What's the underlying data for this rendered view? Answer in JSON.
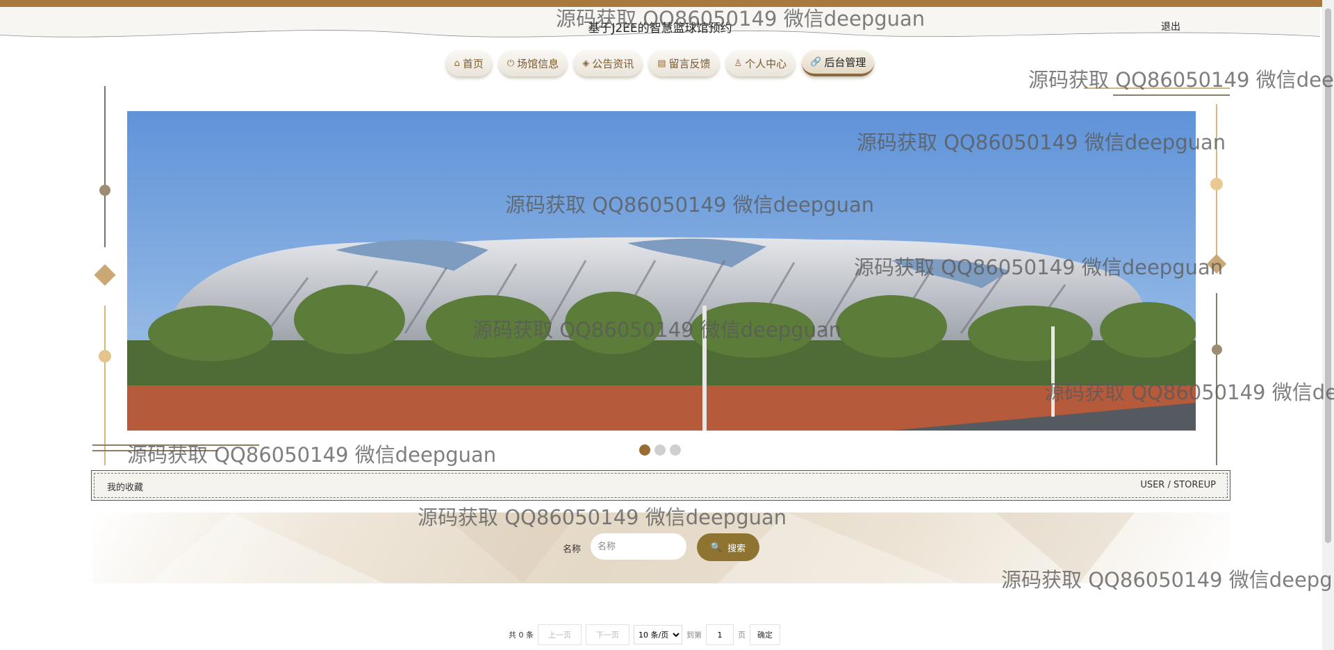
{
  "header": {
    "title": "基于J2EE的智慧篮球馆预约",
    "logout": "退出",
    "accent_color": "#a8783c"
  },
  "nav": {
    "items": [
      {
        "label": "首页",
        "icon": "home-icon"
      },
      {
        "label": "场馆信息",
        "icon": "power-icon"
      },
      {
        "label": "公告资讯",
        "icon": "layers-icon"
      },
      {
        "label": "留言反馈",
        "icon": "note-icon"
      },
      {
        "label": "个人中心",
        "icon": "user-icon"
      },
      {
        "label": "后台管理",
        "icon": "link-icon"
      }
    ],
    "active": "后台管理"
  },
  "banner": {
    "alt": "basketball arena stadium photo",
    "slide_count": 3,
    "current_slide": 1
  },
  "section": {
    "title": "我的收藏",
    "subtitle": "USER / STOREUP"
  },
  "search": {
    "label": "名称",
    "placeholder": "名称",
    "value": "",
    "button_label": "搜索",
    "button_color": "#8f7330"
  },
  "pagination": {
    "total_text": "共 0 条",
    "prev_label": "上一页",
    "next_label": "下一页",
    "page_size_option": "10 条/页",
    "goto_label": "到第",
    "page_value": "1",
    "page_unit": "页",
    "confirm_label": "确定"
  },
  "watermark": {
    "text": "源码获取 QQ86050149 微信deepguan"
  }
}
